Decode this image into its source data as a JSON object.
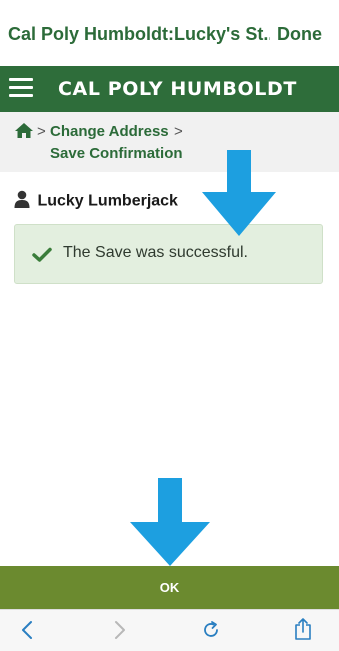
{
  "browser": {
    "title": "Cal Poly Humboldt:Lucky's St...",
    "done_label": "Done"
  },
  "header": {
    "brand": "CAL POLY HUMBOLDT",
    "menu_icon": "hamburger-icon"
  },
  "breadcrumb": {
    "home_icon": "home-icon",
    "items": [
      "Change Address",
      "Save Confirmation"
    ],
    "separator": ">"
  },
  "user": {
    "icon": "person-icon",
    "name": "Lucky Lumberjack"
  },
  "alert": {
    "icon": "checkmark-icon",
    "message": "The Save was successful."
  },
  "actions": {
    "ok_label": "OK"
  },
  "bottom_nav": {
    "icons": [
      "back-icon",
      "forward-icon",
      "reload-icon",
      "share-icon"
    ]
  },
  "colors": {
    "brand_green": "#2e6d3a",
    "ok_green": "#6b8a2f",
    "alert_bg": "#e3efdf",
    "annotation_arrow": "#1d9fe0"
  }
}
